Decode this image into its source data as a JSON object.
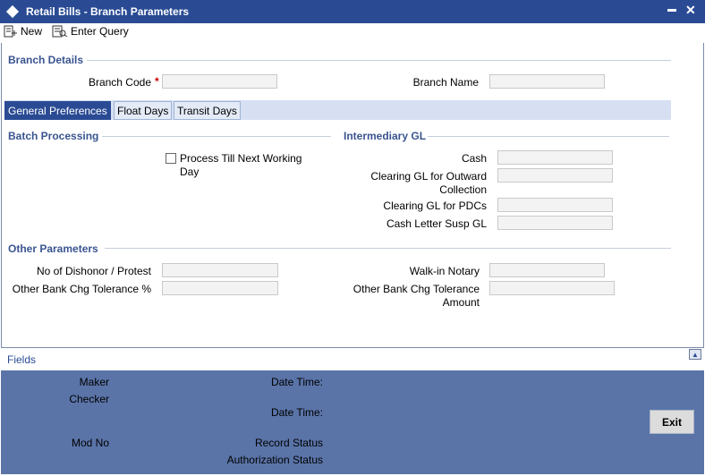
{
  "window": {
    "title": "Retail Bills - Branch Parameters",
    "minimize": "▬",
    "close": "✕"
  },
  "toolbar": {
    "new_label": "New",
    "enter_query_label": "Enter Query"
  },
  "branch_details": {
    "title": "Branch Details",
    "branch_code_label": "Branch Code",
    "required_mark": "*",
    "branch_code_value": "",
    "branch_name_label": "Branch Name",
    "branch_name_value": ""
  },
  "tabs": [
    {
      "label": "General Preferences",
      "active": true
    },
    {
      "label": "Float Days",
      "active": false
    },
    {
      "label": "Transit Days",
      "active": false
    }
  ],
  "batch_processing": {
    "title": "Batch Processing",
    "process_label_line1": "Process Till Next Working",
    "process_label_line2": "Day",
    "checked": false
  },
  "intermediary_gl": {
    "title": "Intermediary GL",
    "cash_label": "Cash",
    "clearing_outward_line1": "Clearing GL for Outward",
    "clearing_outward_line2": "Collection",
    "clearing_pdcs_label": "Clearing GL for PDCs",
    "cash_letter_label": "Cash Letter Susp GL"
  },
  "other_parameters": {
    "title": "Other Parameters",
    "dishonor_label": "No of Dishonor / Protest",
    "tolerance_pct_label": "Other Bank Chg Tolerance %",
    "walkin_label": "Walk-in Notary",
    "tolerance_amt_line1": "Other Bank Chg Tolerance",
    "tolerance_amt_line2": "Amount"
  },
  "fields": {
    "label": "Fields",
    "collapse_icon": "▲"
  },
  "footer": {
    "maker": "Maker",
    "date_time_1": "Date Time:",
    "checker": "Checker",
    "date_time_2": "Date Time:",
    "mod_no": "Mod No",
    "record_status": "Record Status",
    "authorization_status": "Authorization Status",
    "exit_label": "Exit"
  },
  "colors": {
    "title_bar": "#2a4b94",
    "section_title": "#3a5590",
    "footer_bg": "#5a74a8",
    "required": "#cc0000"
  }
}
